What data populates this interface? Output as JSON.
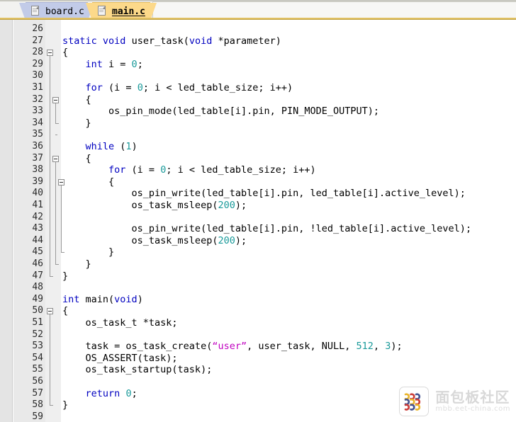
{
  "tabs": [
    {
      "label": "board.c",
      "active": false,
      "icon": "file-icon"
    },
    {
      "label": "main.c",
      "active": true,
      "icon": "file-icon"
    }
  ],
  "editor": {
    "language": "c",
    "first_line": 26,
    "last_line": 59,
    "colors": {
      "keyword": "#0000c0",
      "number": "#1a9a9a",
      "string": "#c000c0",
      "text": "#000000",
      "gutter_bg": "#e9e9e9",
      "active_tab": "#fcd98a",
      "inactive_tab": "#c2cbe8"
    },
    "lines": [
      {
        "n": 26,
        "tokens": []
      },
      {
        "n": 27,
        "tokens": [
          {
            "t": "static",
            "c": "kw"
          },
          {
            "t": " "
          },
          {
            "t": "void",
            "c": "kw"
          },
          {
            "t": " user_task("
          },
          {
            "t": "void",
            "c": "kw"
          },
          {
            "t": " *parameter)"
          }
        ]
      },
      {
        "n": 28,
        "tokens": [
          {
            "t": "{"
          }
        ],
        "fold": "open"
      },
      {
        "n": 29,
        "tokens": [
          {
            "t": "    "
          },
          {
            "t": "int",
            "c": "kw"
          },
          {
            "t": " i = "
          },
          {
            "t": "0",
            "c": "num"
          },
          {
            "t": ";"
          }
        ]
      },
      {
        "n": 30,
        "tokens": []
      },
      {
        "n": 31,
        "tokens": [
          {
            "t": "    "
          },
          {
            "t": "for",
            "c": "kw"
          },
          {
            "t": " (i = "
          },
          {
            "t": "0",
            "c": "num"
          },
          {
            "t": "; i < led_table_size; i++)"
          }
        ]
      },
      {
        "n": 32,
        "tokens": [
          {
            "t": "    {"
          }
        ],
        "fold": "open"
      },
      {
        "n": 33,
        "tokens": [
          {
            "t": "        os_pin_mode(led_table[i].pin, PIN_MODE_OUTPUT);"
          }
        ]
      },
      {
        "n": 34,
        "tokens": [
          {
            "t": "    }"
          }
        ]
      },
      {
        "n": 35,
        "tokens": []
      },
      {
        "n": 36,
        "tokens": [
          {
            "t": "    "
          },
          {
            "t": "while",
            "c": "kw"
          },
          {
            "t": " ("
          },
          {
            "t": "1",
            "c": "num"
          },
          {
            "t": ")"
          }
        ]
      },
      {
        "n": 37,
        "tokens": [
          {
            "t": "    {"
          }
        ],
        "fold": "open"
      },
      {
        "n": 38,
        "tokens": [
          {
            "t": "        "
          },
          {
            "t": "for",
            "c": "kw"
          },
          {
            "t": " (i = "
          },
          {
            "t": "0",
            "c": "num"
          },
          {
            "t": "; i < led_table_size; i++)"
          }
        ]
      },
      {
        "n": 39,
        "tokens": [
          {
            "t": "        {"
          }
        ],
        "fold": "open"
      },
      {
        "n": 40,
        "tokens": [
          {
            "t": "            os_pin_write(led_table[i].pin, led_table[i].active_level);"
          }
        ]
      },
      {
        "n": 41,
        "tokens": [
          {
            "t": "            os_task_msleep("
          },
          {
            "t": "200",
            "c": "num"
          },
          {
            "t": ");"
          }
        ]
      },
      {
        "n": 42,
        "tokens": []
      },
      {
        "n": 43,
        "tokens": [
          {
            "t": "            os_pin_write(led_table[i].pin, !led_table[i].active_level);"
          }
        ]
      },
      {
        "n": 44,
        "tokens": [
          {
            "t": "            os_task_msleep("
          },
          {
            "t": "200",
            "c": "num"
          },
          {
            "t": ");"
          }
        ]
      },
      {
        "n": 45,
        "tokens": [
          {
            "t": "        }"
          }
        ]
      },
      {
        "n": 46,
        "tokens": [
          {
            "t": "    }"
          }
        ]
      },
      {
        "n": 47,
        "tokens": [
          {
            "t": "}"
          }
        ]
      },
      {
        "n": 48,
        "tokens": []
      },
      {
        "n": 49,
        "tokens": [
          {
            "t": "int",
            "c": "kw"
          },
          {
            "t": " main("
          },
          {
            "t": "void",
            "c": "kw"
          },
          {
            "t": ")"
          }
        ]
      },
      {
        "n": 50,
        "tokens": [
          {
            "t": "{"
          }
        ],
        "fold": "open"
      },
      {
        "n": 51,
        "tokens": [
          {
            "t": "    os_task_t *task;"
          }
        ]
      },
      {
        "n": 52,
        "tokens": []
      },
      {
        "n": 53,
        "tokens": [
          {
            "t": "    task = os_task_create("
          },
          {
            "t": "“user”",
            "c": "str"
          },
          {
            "t": ", user_task, NULL, "
          },
          {
            "t": "512",
            "c": "num"
          },
          {
            "t": ", "
          },
          {
            "t": "3",
            "c": "num"
          },
          {
            "t": ");"
          }
        ]
      },
      {
        "n": 54,
        "tokens": [
          {
            "t": "    OS_ASSERT(task);"
          }
        ]
      },
      {
        "n": 55,
        "tokens": [
          {
            "t": "    os_task_startup(task);"
          }
        ]
      },
      {
        "n": 56,
        "tokens": []
      },
      {
        "n": 57,
        "tokens": [
          {
            "t": "    "
          },
          {
            "t": "return",
            "c": "kw"
          },
          {
            "t": " "
          },
          {
            "t": "0",
            "c": "num"
          },
          {
            "t": ";"
          }
        ]
      },
      {
        "n": 58,
        "tokens": [
          {
            "t": "}"
          }
        ]
      },
      {
        "n": 59,
        "tokens": []
      }
    ]
  },
  "watermark": {
    "title": "面包板社区",
    "url": "mbb.eet-china.com"
  }
}
